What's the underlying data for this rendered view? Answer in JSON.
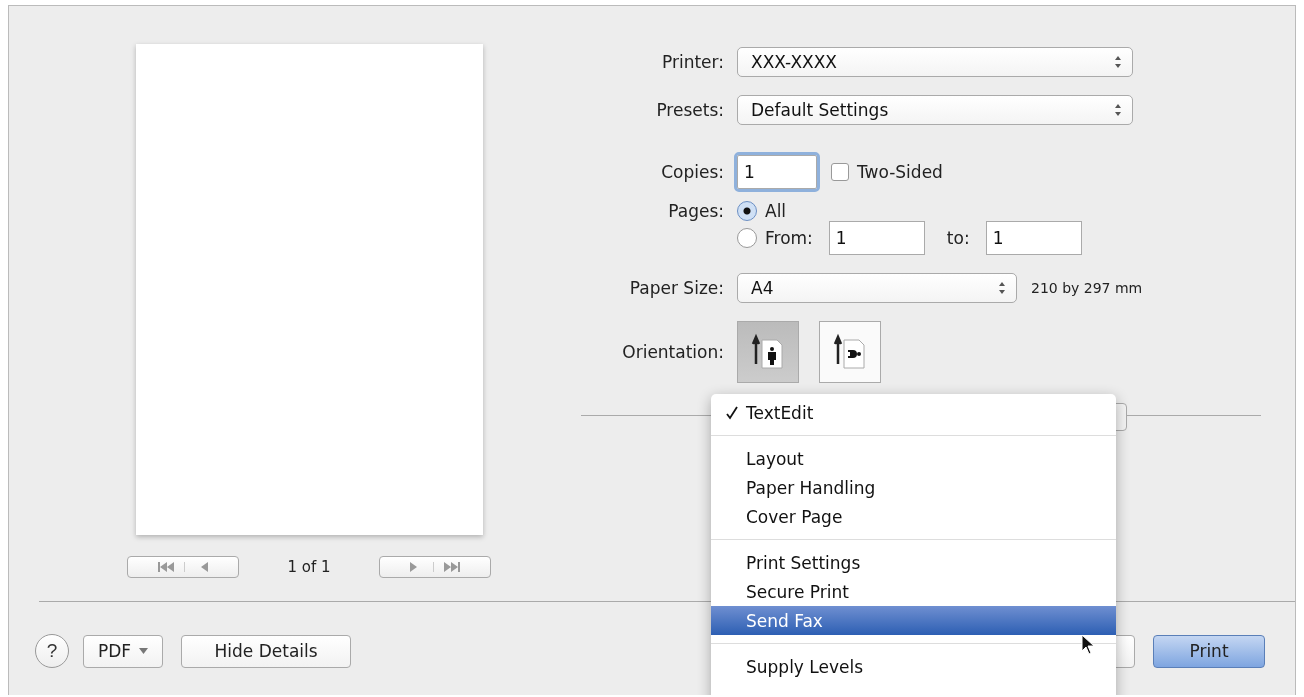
{
  "preview": {
    "page_counter": "1 of 1"
  },
  "printer": {
    "label": "Printer:",
    "value": "XXX-XXXX"
  },
  "presets": {
    "label": "Presets:",
    "value": "Default Settings"
  },
  "copies": {
    "label": "Copies:",
    "value": "1",
    "two_sided": {
      "label": "Two-Sided",
      "checked": false
    }
  },
  "pages": {
    "label": "Pages:",
    "options": [
      {
        "label": "All",
        "selected": true
      },
      {
        "label": "From:",
        "selected": false
      }
    ],
    "from": "1",
    "to_label": "to:",
    "to": "1"
  },
  "paper_size": {
    "label": "Paper Size:",
    "value": "A4",
    "dimensions": "210 by 297 mm"
  },
  "orientation": {
    "label": "Orientation:",
    "options": [
      {
        "kind": "portrait",
        "selected": true
      },
      {
        "kind": "landscape",
        "selected": false
      }
    ]
  },
  "menu": {
    "sections": [
      [
        {
          "label": "TextEdit",
          "checked": true,
          "selected": false
        }
      ],
      [
        {
          "label": "Layout",
          "checked": false,
          "selected": false
        },
        {
          "label": "Paper Handling",
          "checked": false,
          "selected": false
        },
        {
          "label": "Cover Page",
          "checked": false,
          "selected": false
        }
      ],
      [
        {
          "label": "Print Settings",
          "checked": false,
          "selected": false
        },
        {
          "label": "Secure Print",
          "checked": false,
          "selected": false
        },
        {
          "label": "Send Fax",
          "checked": false,
          "selected": true
        }
      ],
      [
        {
          "label": "Supply Levels",
          "checked": false,
          "selected": false
        }
      ]
    ]
  },
  "footer": {
    "help": "?",
    "pdf": "PDF",
    "hide_details": "Hide Details",
    "print": "Print"
  }
}
